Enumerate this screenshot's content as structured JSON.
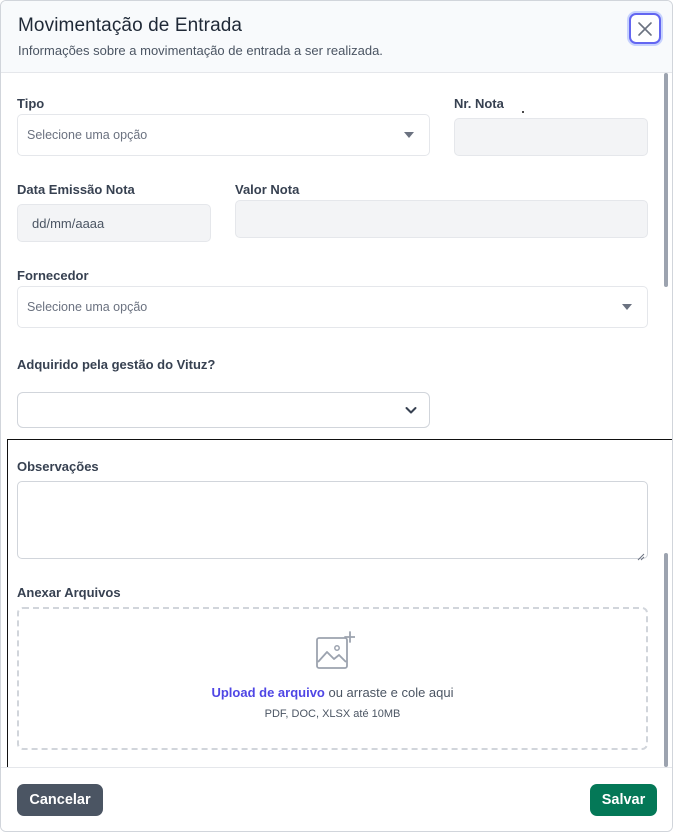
{
  "modal": {
    "title": "Movimentação de Entrada",
    "subtitle": "Informações sobre a movimentação de entrada a ser realizada.",
    "close_icon": "close-icon"
  },
  "form": {
    "tipo": {
      "label": "Tipo",
      "placeholder": "Selecione uma opção"
    },
    "nr_nota": {
      "label": "Nr. Nota",
      "value": ""
    },
    "data_emissao": {
      "label": "Data Emissão Nota",
      "placeholder": "dd/mm/aaaa"
    },
    "valor_nota": {
      "label": "Valor Nota",
      "value": ""
    },
    "fornecedor": {
      "label": "Fornecedor",
      "placeholder": "Selecione uma opção"
    },
    "adquirido": {
      "label": "Adquirido pela gestão do Vituz?",
      "value": ""
    },
    "observacoes": {
      "label": "Observações",
      "value": ""
    },
    "anexar": {
      "label": "Anexar Arquivos",
      "upload_link": "Upload de arquivo",
      "upload_rest": " ou arraste e cole aqui",
      "hint": "PDF, DOC, XLSX até 10MB",
      "icon": "image-add-icon"
    }
  },
  "footer": {
    "cancel_label": "Cancelar",
    "save_label": "Salvar"
  },
  "colors": {
    "accent": "#4f46e5",
    "save": "#047857",
    "cancel": "#4b5563",
    "close_border": "#6366f1"
  }
}
